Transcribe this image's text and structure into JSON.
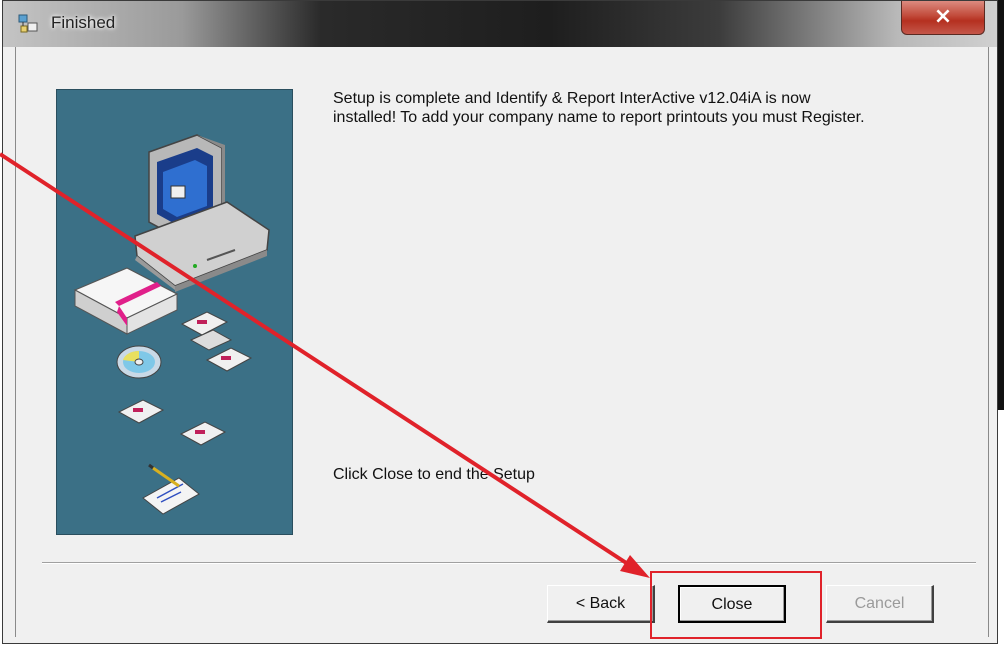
{
  "window": {
    "title": "Finished",
    "close_symbol": "×"
  },
  "content": {
    "message_lines": [
      "Setup is complete and Identify & Report InterActive v12.04iA is now",
      "installed! To add your company name to report printouts you must Register."
    ],
    "instruction": "Click Close to end the Setup"
  },
  "buttons": {
    "back_label": "< Back",
    "close_label": "Close",
    "cancel_label": "Cancel",
    "cancel_enabled": false,
    "default_button": "close"
  },
  "annotation": {
    "color": "#e0222a",
    "target": "close-button"
  },
  "colors": {
    "panel": "#3b7086",
    "dialog_bg": "#f0f0f0"
  }
}
